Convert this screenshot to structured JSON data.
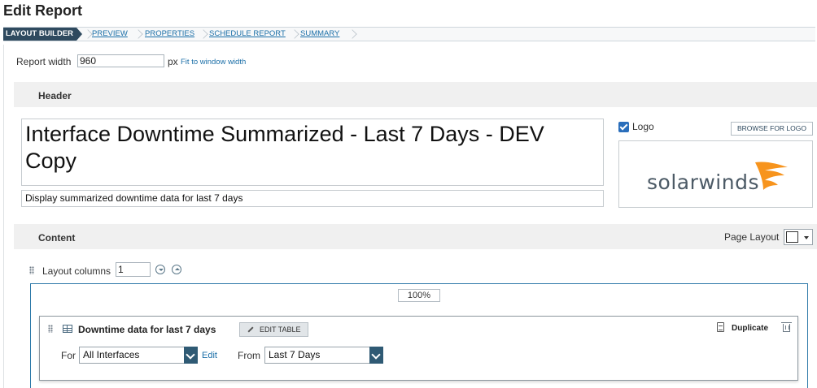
{
  "page": {
    "title": "Edit Report"
  },
  "steps": [
    {
      "label": "LAYOUT BUILDER",
      "active": true
    },
    {
      "label": "PREVIEW",
      "active": false
    },
    {
      "label": "PROPERTIES",
      "active": false
    },
    {
      "label": "SCHEDULE REPORT",
      "active": false
    },
    {
      "label": "SUMMARY",
      "active": false
    }
  ],
  "report_width": {
    "label": "Report width",
    "value": "960",
    "unit": "px",
    "fit_link": "Fit to window width"
  },
  "header": {
    "section_title": "Header",
    "report_title": "Interface Downtime Summarized - Last 7 Days - DEV Copy",
    "report_subtitle": "Display summarized downtime data for last 7 days",
    "logo_label": "Logo",
    "logo_checked": true,
    "browse_button": "BROWSE FOR LOGO",
    "logo_text": "solarwinds",
    "logo_color": "#f7941d"
  },
  "content": {
    "section_title": "Content",
    "page_layout_label": "Page Layout",
    "layout_columns_label": "Layout columns",
    "layout_columns_value": "1",
    "column_width": "100%"
  },
  "widget": {
    "title": "Downtime data for last 7 days",
    "edit_table_button": "EDIT TABLE",
    "duplicate_label": "Duplicate",
    "for_label": "For",
    "for_value": "All Interfaces",
    "edit_link": "Edit",
    "from_label": "From",
    "from_value": "Last 7 Days"
  },
  "colors": {
    "accent": "#2f4a5f",
    "link": "#1b6fa8",
    "frame": "#2c78a8"
  }
}
